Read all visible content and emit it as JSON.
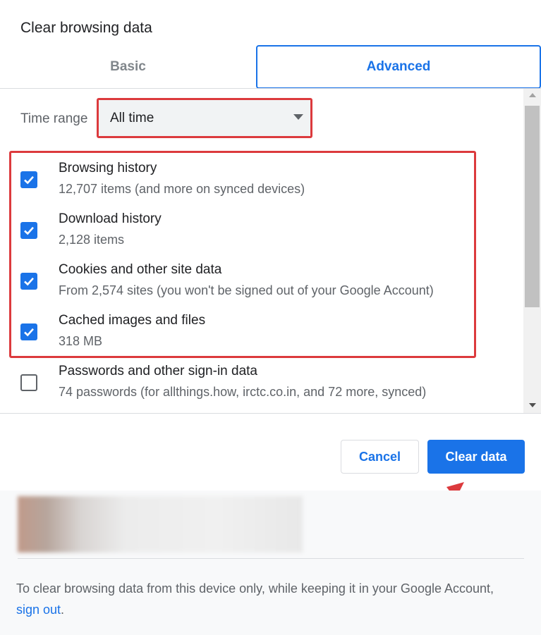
{
  "dialog": {
    "title": "Clear browsing data",
    "tabs": [
      {
        "label": "Basic",
        "active": false
      },
      {
        "label": "Advanced",
        "active": true
      }
    ]
  },
  "time_range": {
    "label": "Time range",
    "value": "All time"
  },
  "options": [
    {
      "title": "Browsing history",
      "subtitle": "12,707 items (and more on synced devices)",
      "checked": true
    },
    {
      "title": "Download history",
      "subtitle": "2,128 items",
      "checked": true
    },
    {
      "title": "Cookies and other site data",
      "subtitle": "From 2,574 sites (you won't be signed out of your Google Account)",
      "checked": true
    },
    {
      "title": "Cached images and files",
      "subtitle": "318 MB",
      "checked": true
    },
    {
      "title": "Passwords and other sign-in data",
      "subtitle": "74 passwords (for allthings.how, irctc.co.in, and 72 more, synced)",
      "checked": false
    }
  ],
  "actions": {
    "cancel_label": "Cancel",
    "clear_label": "Clear data"
  },
  "footer": {
    "text_before_link": "To clear browsing data from this device only, while keeping it in your Google Account, ",
    "link_label": "sign out",
    "text_after_link": "."
  },
  "colors": {
    "accent": "#1a73e8",
    "highlight_annotation": "#dc3a3d"
  },
  "icons": [
    "check-icon",
    "dropdown-arrow-icon",
    "scroll-up-arrow-icon",
    "scroll-down-arrow-icon",
    "annotation-arrow-icon"
  ]
}
